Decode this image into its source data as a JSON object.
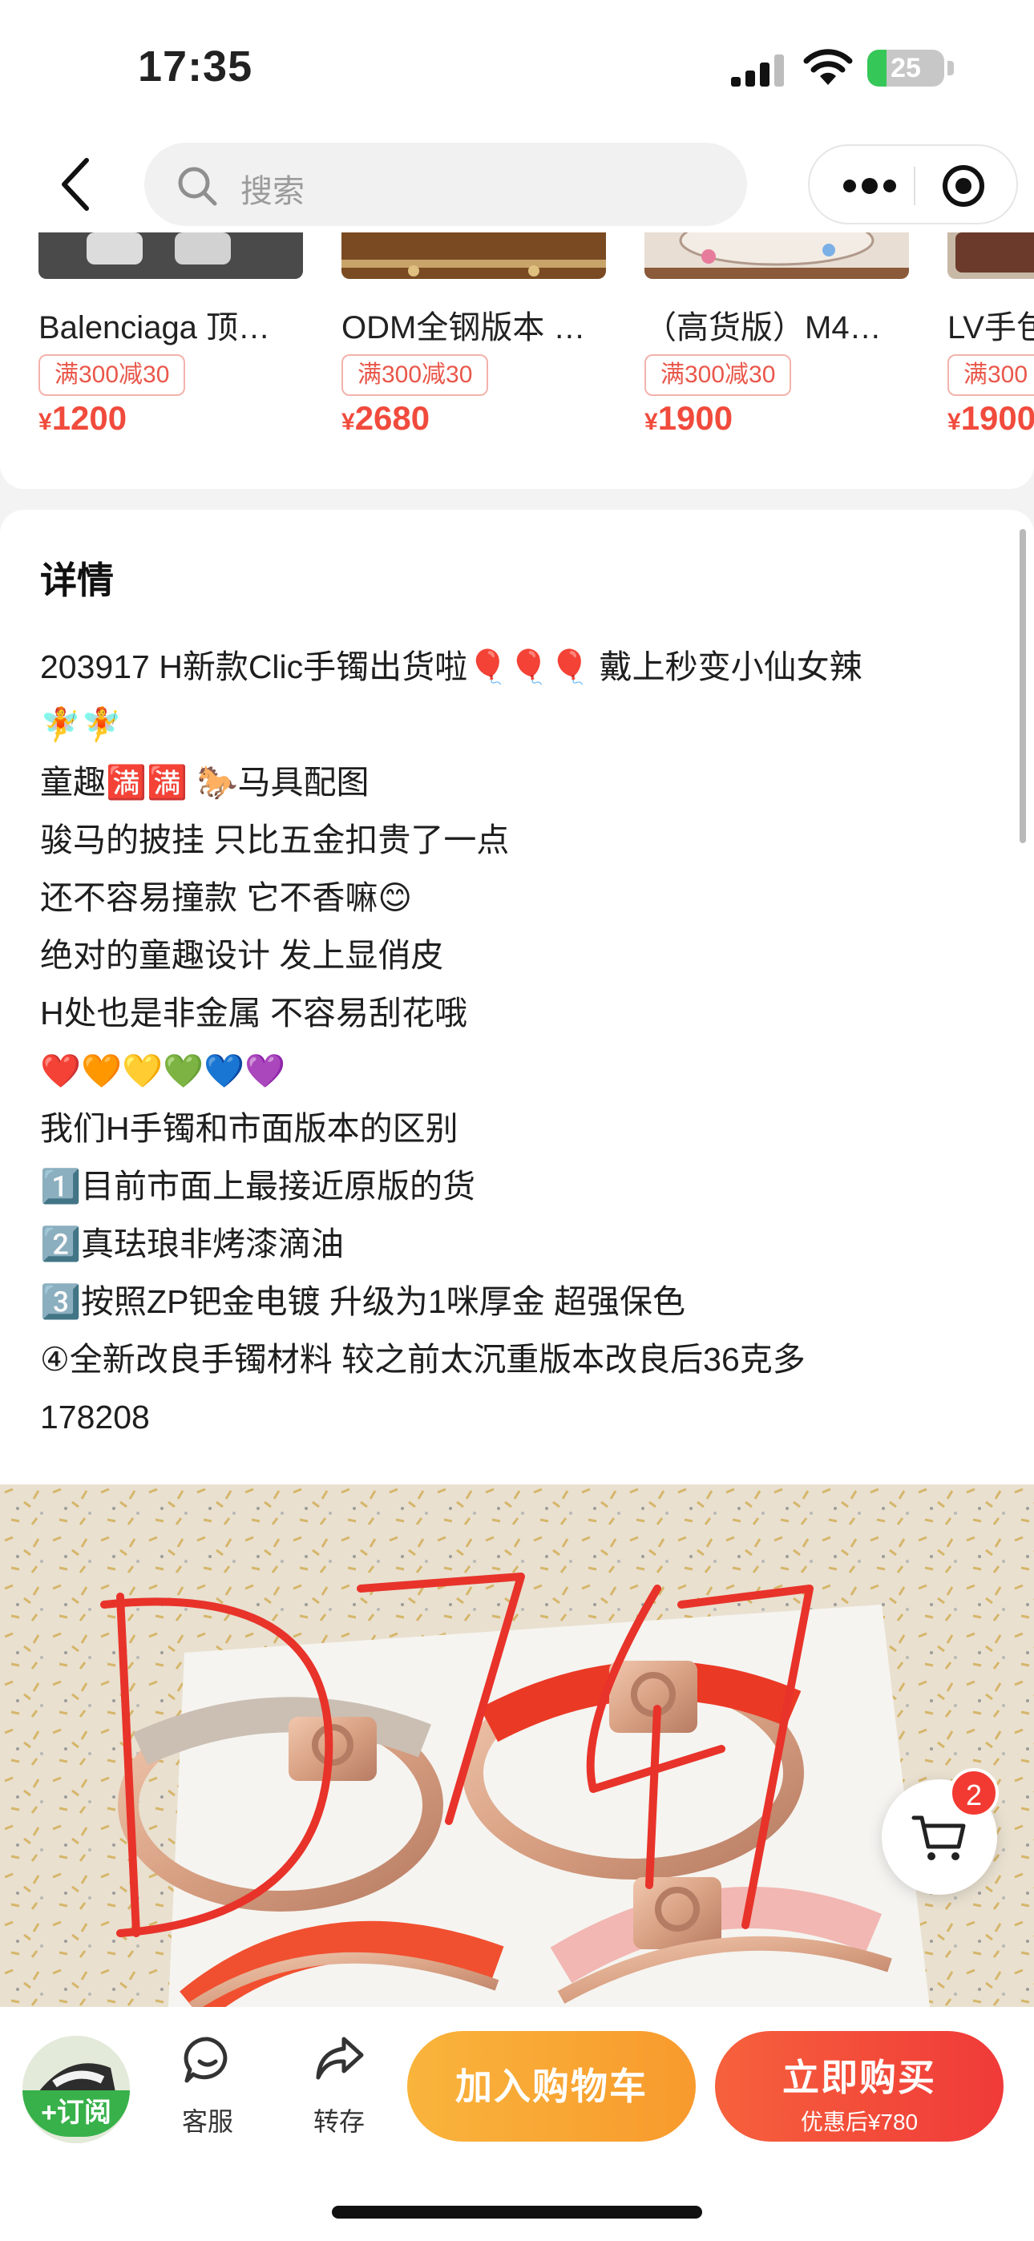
{
  "status_bar": {
    "time": "17:35",
    "battery_level": 25,
    "battery_text": "25",
    "icons": [
      "signal-icon",
      "wifi-icon",
      "battery-icon"
    ]
  },
  "nav": {
    "search_placeholder": "搜索",
    "icons": [
      "back-icon",
      "search-icon",
      "more-icon",
      "close-target-icon"
    ]
  },
  "recommendations": [
    {
      "title": "Balenciaga 顶…",
      "tag": "满300减30",
      "price_symbol": "¥",
      "price": "1200"
    },
    {
      "title": "ODM全钢版本 …",
      "tag": "满300减30",
      "price_symbol": "¥",
      "price": "2680"
    },
    {
      "title": "（高货版）M4…",
      "tag": "满300减30",
      "price_symbol": "¥",
      "price": "1900"
    },
    {
      "title": "LV手包",
      "tag": "满300",
      "price_symbol": "¥",
      "price": "1900"
    }
  ],
  "details": {
    "heading": "详情",
    "lines": [
      "203917 H新款Clic手镯出货啦🎈🎈🎈 戴上秒变小仙女辣",
      "🧚🧚",
      "童趣🈵🈵 🐎马具配图",
      "骏马的披挂 只比五金扣贵了一点",
      "还不容易撞款 它不香嘛😊",
      "绝对的童趣设计 发上显俏皮",
      "H处也是非金属 不容易刮花哦",
      "❤️🧡💛💚💙💜",
      "我们H手镯和市面版本的区别",
      "1️⃣目前市面上最接近原版的货",
      "2️⃣真珐琅非烤漆滴油",
      "3️⃣按照ZP钯金电镀 升级为1咪厚金 超强保色",
      "④全新改良手镯材料 较之前太沉重版本改良后36克多",
      "178208"
    ]
  },
  "photo": {
    "handwritten_mark": "D747",
    "colors": {
      "marker": "#e8332b",
      "background": "#e8dfcf",
      "gold": "#d9a98d"
    }
  },
  "floating_cart": {
    "badge_count": "2"
  },
  "bottom_bar": {
    "subscribe_label": "+订阅",
    "service_label": "客服",
    "share_label": "转存",
    "add_cart_label": "加入购物车",
    "buy_label": "立即购买",
    "buy_sub_label": "优惠后¥780"
  },
  "colors": {
    "price_red": "#f04b3c",
    "cart_orange": "#f9a935",
    "buy_red": "#f34a3a",
    "subscribe_green": "#38b14b"
  }
}
